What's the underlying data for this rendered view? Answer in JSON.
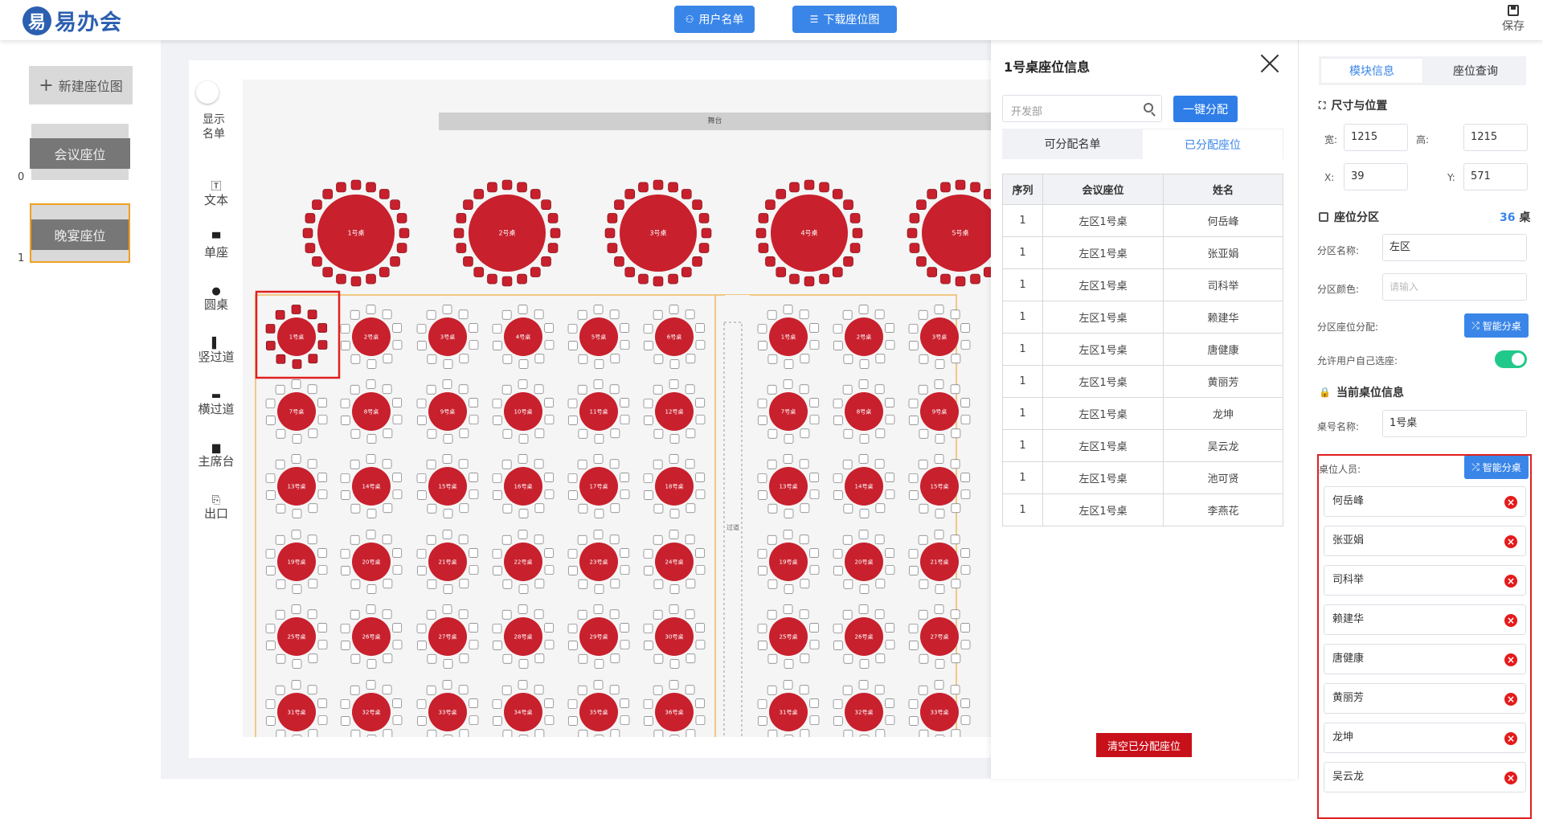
{
  "app": {
    "logo_mark": "易",
    "logo_text": "易办会"
  },
  "toolbar": {
    "user_list": "用户名单",
    "download_map": "下载座位图",
    "save": "保存"
  },
  "left": {
    "new_map": "新建座位图",
    "items": [
      {
        "label": "会议座位",
        "count": "0"
      },
      {
        "label": "晚宴座位",
        "count": "1"
      }
    ]
  },
  "tools": {
    "toggle_label": "显示名单",
    "items": [
      {
        "glyph": "🅃",
        "label": "文本"
      },
      {
        "glyph": "▀",
        "label": "单座"
      },
      {
        "glyph": "●",
        "label": "圆桌"
      },
      {
        "glyph": "▌",
        "label": "竖过道"
      },
      {
        "glyph": "▬",
        "label": "横过道"
      },
      {
        "glyph": "▆",
        "label": "主席台"
      },
      {
        "glyph": "⎘",
        "label": "出口"
      }
    ]
  },
  "stage": {
    "label": "舞台",
    "aisle_label": "过道"
  },
  "banquet_tables": [
    "1号桌",
    "2号桌",
    "3号桌",
    "4号桌",
    "5号桌"
  ],
  "left_zone_tables": [
    "1号桌",
    "2号桌",
    "3号桌",
    "4号桌",
    "5号桌",
    "6号桌",
    "7号桌",
    "8号桌",
    "9号桌",
    "10号桌",
    "11号桌",
    "12号桌",
    "13号桌",
    "14号桌",
    "15号桌",
    "16号桌",
    "17号桌",
    "18号桌",
    "19号桌",
    "20号桌",
    "21号桌",
    "22号桌",
    "23号桌",
    "24号桌",
    "25号桌",
    "26号桌",
    "27号桌",
    "28号桌",
    "29号桌",
    "30号桌",
    "31号桌",
    "32号桌",
    "33号桌",
    "34号桌",
    "35号桌",
    "36号桌"
  ],
  "right_zone_tables": [
    "1号桌",
    "2号桌",
    "3号桌",
    "7号桌",
    "8号桌",
    "9号桌",
    "13号桌",
    "14号桌",
    "15号桌",
    "19号桌",
    "20号桌",
    "21号桌",
    "25号桌",
    "26号桌",
    "27号桌",
    "31号桌",
    "32号桌",
    "33号桌"
  ],
  "panel": {
    "title": "1号桌座位信息",
    "search_placeholder": "开发部",
    "assign_btn": "一键分配",
    "tab_available": "可分配名单",
    "tab_assigned": "已分配座位",
    "columns": [
      "序列",
      "会议座位",
      "姓名"
    ],
    "rows": [
      [
        "1",
        "左区1号桌",
        "何岳峰"
      ],
      [
        "1",
        "左区1号桌",
        "张亚娟"
      ],
      [
        "1",
        "左区1号桌",
        "司科举"
      ],
      [
        "1",
        "左区1号桌",
        "赖建华"
      ],
      [
        "1",
        "左区1号桌",
        "唐健康"
      ],
      [
        "1",
        "左区1号桌",
        "黄丽芳"
      ],
      [
        "1",
        "左区1号桌",
        "龙坤"
      ],
      [
        "1",
        "左区1号桌",
        "吴云龙"
      ],
      [
        "1",
        "左区1号桌",
        "池可贤"
      ],
      [
        "1",
        "左区1号桌",
        "李燕花"
      ]
    ],
    "clear_btn": "清空已分配座位"
  },
  "right": {
    "tab_module": "模块信息",
    "tab_query": "座位查询",
    "size_title": "尺寸与位置",
    "width_label": "宽:",
    "width": "1215",
    "height_label": "高:",
    "height": "1215",
    "x_label": "X:",
    "x": "39",
    "y_label": "Y:",
    "y": "571",
    "zone_title": "座位分区",
    "zone_count": "36",
    "zone_unit": "桌",
    "zone_name_label": "分区名称:",
    "zone_name": "左区",
    "zone_color_label": "分区颜色:",
    "zone_color_placeholder": "请输入",
    "zone_assign_label": "分区座位分配:",
    "smart_btn": "智能分桌",
    "allow_label": "允许用户自己选座:",
    "current_title": "当前桌位信息",
    "table_name_label": "桌号名称:",
    "table_name": "1号桌",
    "people_label": "桌位人员:",
    "people": [
      "何岳峰",
      "张亚娟",
      "司科举",
      "赖建华",
      "唐健康",
      "黄丽芳",
      "龙坤",
      "吴云龙"
    ]
  },
  "colors": {
    "accent": "#3a86e8",
    "table_red": "#c8202d",
    "highlight": "#e02020"
  }
}
